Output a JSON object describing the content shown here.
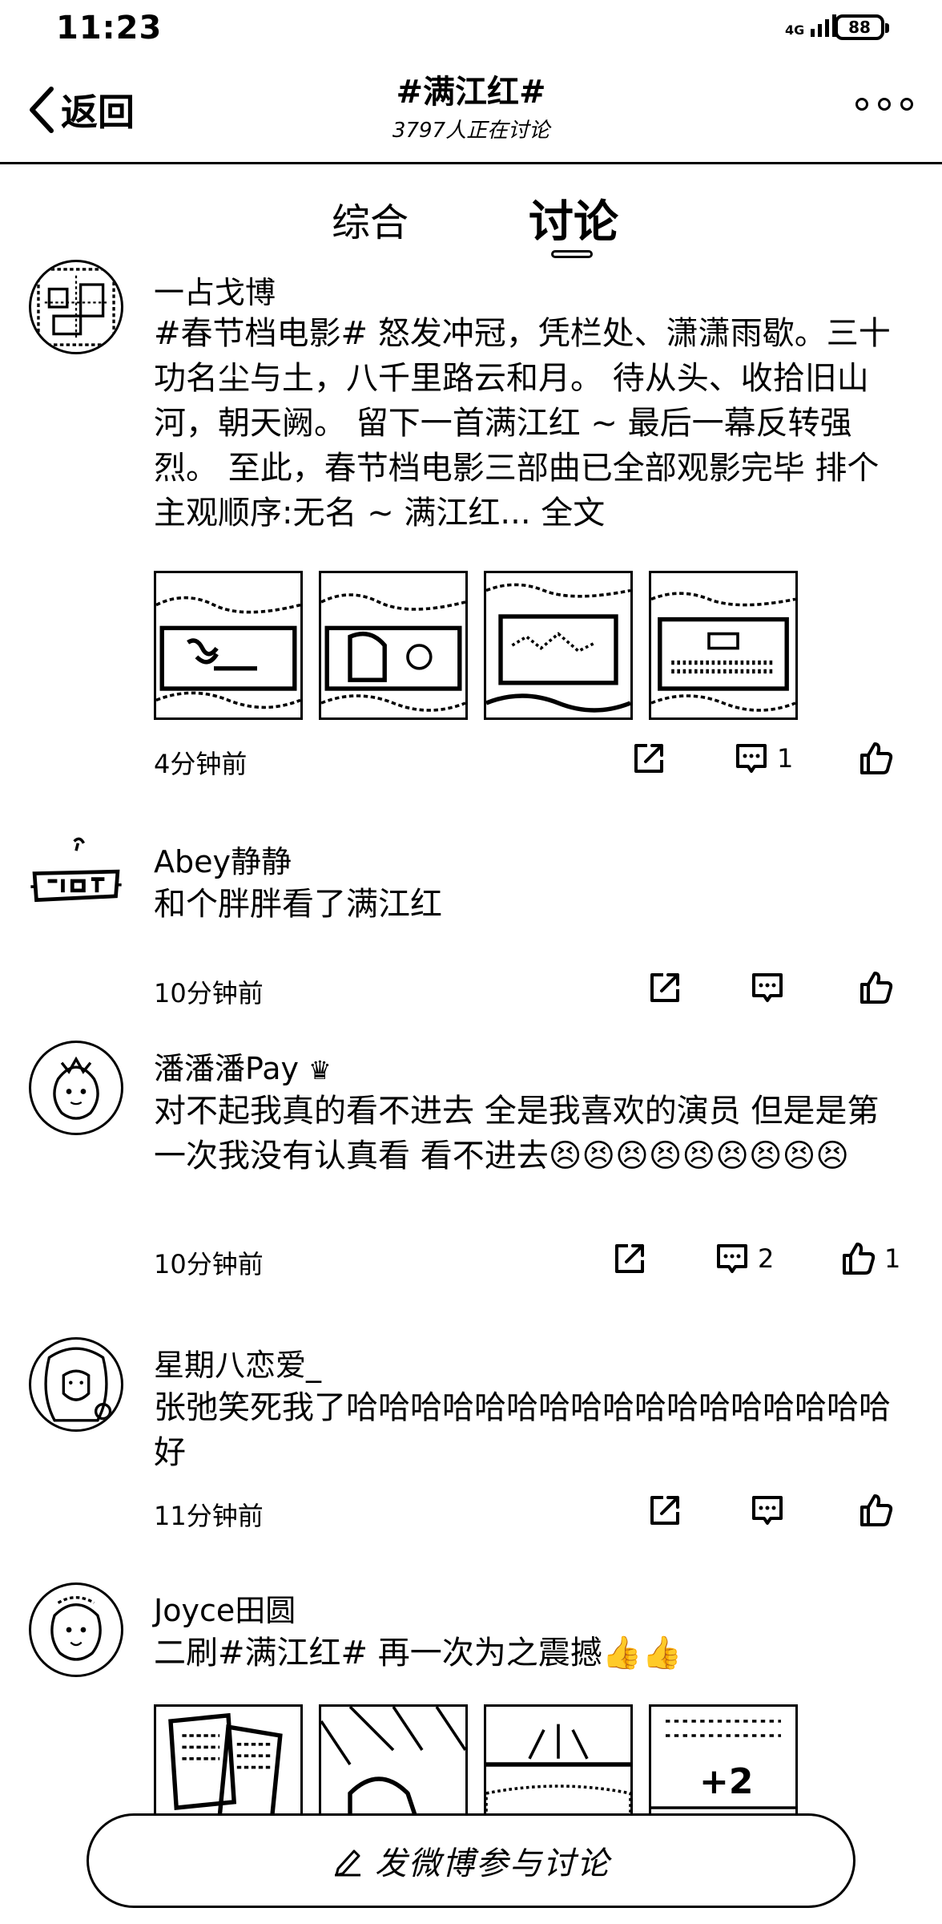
{
  "status": {
    "time": "11:23",
    "network": "4G",
    "battery": "88"
  },
  "header": {
    "back_label": "返回",
    "title": "#满江红#",
    "subtitle": "3797人正在讨论"
  },
  "tabs": [
    "综合",
    "讨论"
  ],
  "posts": [
    {
      "user": "一占戈博",
      "text": "#春节档电影# 怒发冲冠，凭栏处、潇潇雨歇。三十功名尘与土，八千里路云和月。 待从头、收拾旧山河，朝天阙。 留下一首满江红 ~ 最后一幕反转强烈。 至此，春节档电影三部曲已全部观影完毕 排个主观顺序:无名 ~ 满江红...",
      "more": "全文",
      "time": "4分钟前",
      "comments": "1",
      "likes": ""
    },
    {
      "user": "Abey静静",
      "text": "和个胖胖看了满江红",
      "time": "10分钟前",
      "comments": "",
      "likes": ""
    },
    {
      "user": "潘潘潘Pay",
      "text": "对不起我真的看不进去  全是我喜欢的演员  但是是第一次我没有认真看  看不进去😣😣😣😣😣😣😣😣😣",
      "time": "10分钟前",
      "comments": "2",
      "likes": "1"
    },
    {
      "user": "星期八恋爱_",
      "text": "张弛笑死我了哈哈哈哈哈哈哈哈哈哈哈哈哈哈哈哈哈好",
      "time": "11分钟前",
      "comments": "",
      "likes": ""
    },
    {
      "user": "Joyce田圆",
      "text": "二刷#满江红# 再一次为之震撼👍👍",
      "more_images": "+2"
    }
  ],
  "compose": {
    "label": "发微博参与讨论"
  }
}
